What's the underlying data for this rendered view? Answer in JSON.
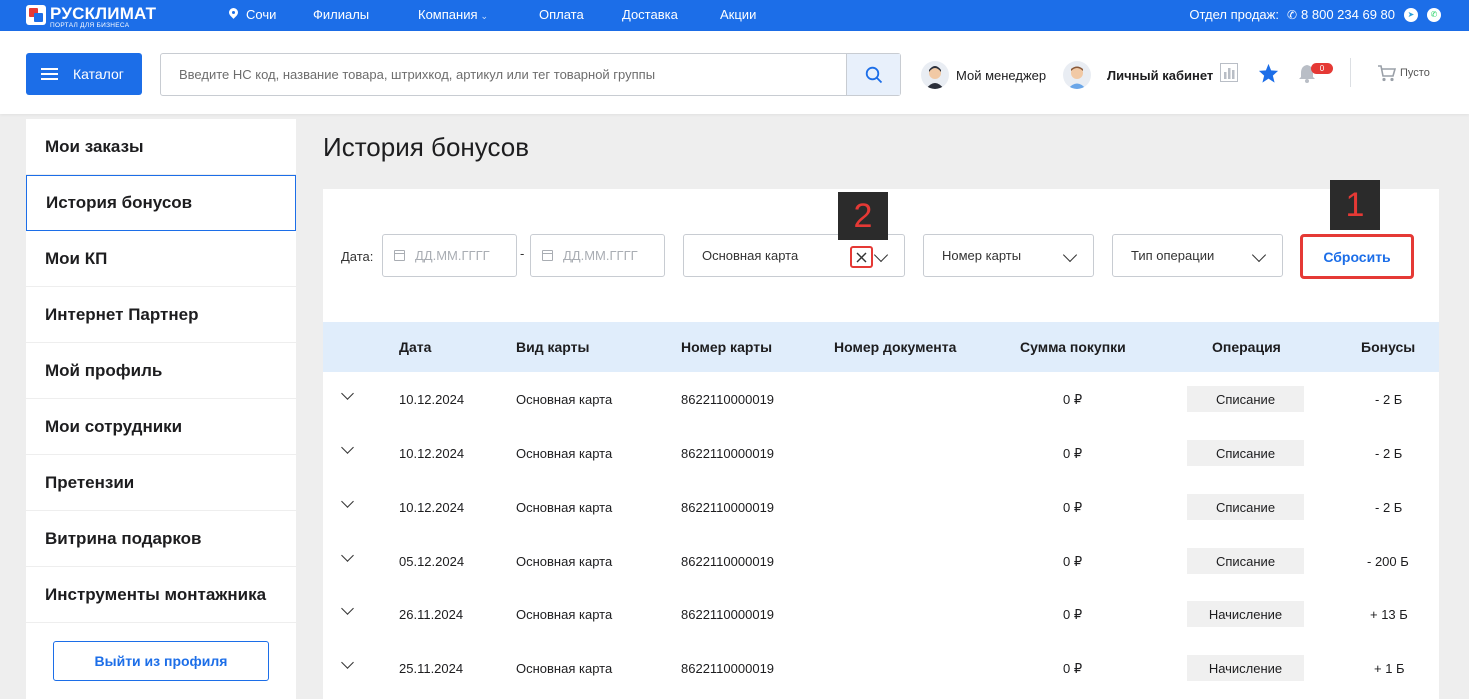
{
  "topbar": {
    "logo_name": "РУСКЛИМАТ",
    "logo_sub": "ПОРТАЛ ДЛЯ БИЗНЕСА",
    "city": "Сочи",
    "nav": [
      "Филиалы",
      "Компания",
      "Оплата",
      "Доставка",
      "Акции"
    ],
    "sales_label": "Отдел продаж:",
    "phone": "8 800 234 69 80"
  },
  "header": {
    "catalog_label": "Каталог",
    "search_placeholder": "Введите НС код, название товара, штрихкод, артикул или тег товарной группы",
    "manager_label": "Мой менеджер",
    "cabinet_label": "Личный кабинет",
    "notifications_count": "0",
    "cart_label": "Пусто"
  },
  "sidebar": {
    "items": [
      {
        "label": "Мои заказы"
      },
      {
        "label": "История бонусов"
      },
      {
        "label": "Мои КП"
      },
      {
        "label": "Интернет Партнер"
      },
      {
        "label": "Мой профиль"
      },
      {
        "label": "Мои сотрудники"
      },
      {
        "label": "Претензии"
      },
      {
        "label": "Витрина подарков"
      },
      {
        "label": "Инструменты монтажника"
      }
    ],
    "active_index": 1,
    "logout_label": "Выйти из профиля"
  },
  "main": {
    "title": "История бонусов",
    "filters": {
      "date_label": "Дата:",
      "date_from_placeholder": "ДД.ММ.ГГГГ",
      "date_separator": "-",
      "date_to_placeholder": "ДД.ММ.ГГГГ",
      "card_type_value": "Основная карта",
      "card_number_label": "Номер карты",
      "operation_type_label": "Тип операции",
      "reset_label": "Сбросить"
    },
    "callouts": [
      "1",
      "2"
    ],
    "table": {
      "columns": [
        "Дата",
        "Вид карты",
        "Номер карты",
        "Номер документа",
        "Сумма покупки",
        "Операция",
        "Бонусы"
      ],
      "rows": [
        {
          "date": "10.12.2024",
          "card_type": "Основная карта",
          "card_number": "8622110000019",
          "doc": "",
          "sum": "0 ₽",
          "operation": "Списание",
          "bonus": "- 2 Б"
        },
        {
          "date": "10.12.2024",
          "card_type": "Основная карта",
          "card_number": "8622110000019",
          "doc": "",
          "sum": "0 ₽",
          "operation": "Списание",
          "bonus": "- 2 Б"
        },
        {
          "date": "10.12.2024",
          "card_type": "Основная карта",
          "card_number": "8622110000019",
          "doc": "",
          "sum": "0 ₽",
          "operation": "Списание",
          "bonus": "- 2 Б"
        },
        {
          "date": "05.12.2024",
          "card_type": "Основная карта",
          "card_number": "8622110000019",
          "doc": "",
          "sum": "0 ₽",
          "operation": "Списание",
          "bonus": "- 200 Б"
        },
        {
          "date": "26.11.2024",
          "card_type": "Основная карта",
          "card_number": "8622110000019",
          "doc": "",
          "sum": "0 ₽",
          "operation": "Начисление",
          "bonus": "+ 13 Б"
        },
        {
          "date": "25.11.2024",
          "card_type": "Основная карта",
          "card_number": "8622110000019",
          "doc": "",
          "sum": "0 ₽",
          "operation": "Начисление",
          "bonus": "+ 1 Б"
        }
      ]
    }
  },
  "colors": {
    "brand_blue": "#1c6ee8",
    "highlight_red": "#e53935",
    "table_header_bg": "#e0edfb"
  },
  "icons": [
    "logo-icon",
    "location-pin-icon",
    "phone-icon",
    "telegram-icon",
    "whatsapp-icon",
    "menu-icon",
    "search-icon",
    "manager-avatar-icon",
    "user-avatar-icon",
    "chart-icon",
    "star-icon",
    "bell-icon",
    "cart-icon",
    "calendar-icon",
    "close-icon",
    "chevron-down-icon"
  ]
}
